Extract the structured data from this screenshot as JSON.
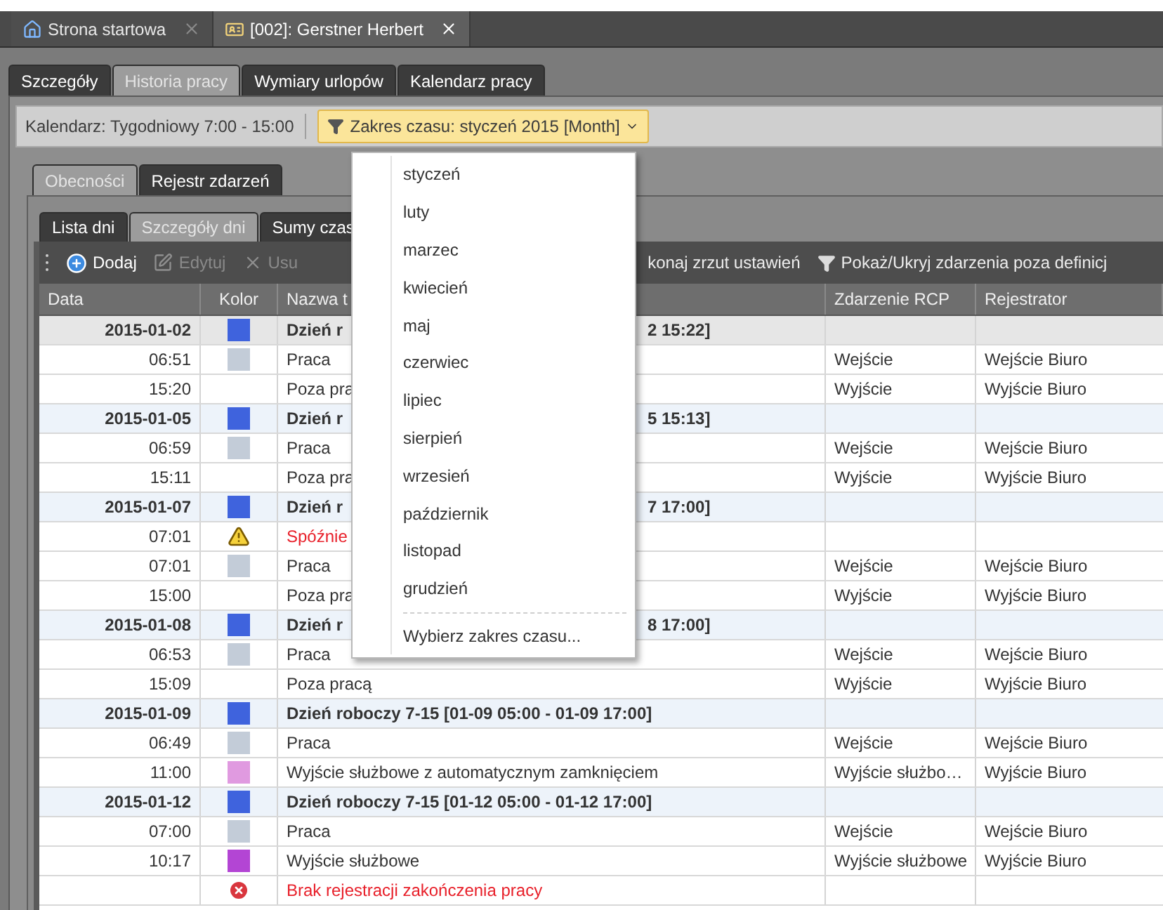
{
  "document_tabs": [
    {
      "label": "Strona startowa",
      "selected": false
    },
    {
      "label": "[002]: Gerstner Herbert",
      "selected": true
    }
  ],
  "section_tabs": [
    {
      "label": "Szczegóły",
      "selected": false
    },
    {
      "label": "Historia pracy",
      "selected": true
    },
    {
      "label": "Wymiary urlopów",
      "selected": false
    },
    {
      "label": "Kalendarz pracy",
      "selected": false
    }
  ],
  "toolbar": {
    "calendar": "Kalendarz: Tygodniowy 7:00 - 15:00",
    "range_button": "Zakres czasu: styczeń 2015 [Month]"
  },
  "view_tabs": [
    {
      "label": "Obecności",
      "selected": true
    },
    {
      "label": "Rejestr zdarzeń",
      "selected": false
    }
  ],
  "sub_tabs": [
    {
      "label": "Lista dni",
      "selected": false
    },
    {
      "label": "Szczegóły dni",
      "selected": true
    },
    {
      "label": "Sumy czas",
      "selected": false
    }
  ],
  "actions": [
    {
      "label": "Dodaj",
      "disabled": false
    },
    {
      "label": "Edytuj",
      "disabled": true
    },
    {
      "label": "Usu",
      "disabled": true
    }
  ],
  "actions_right": [
    "konaj zrzut ustawień",
    "Pokaż/Ukryj zdarzenia poza definicj"
  ],
  "table": {
    "columns": [
      "Data",
      "Kolor",
      "Nazwa t",
      "Zdarzenie RCP",
      "Rejestrator"
    ],
    "rows": [
      {
        "kind": "day",
        "date": "2015-01-02",
        "color": "#3f63dd",
        "name": "Dzień r",
        "name_tail": "2 15:22]",
        "selected": true
      },
      {
        "kind": "event",
        "date": "06:51",
        "color": "#c3ccd8",
        "name": "Praca",
        "event": "Wejście",
        "recorder": "Wejście Biuro"
      },
      {
        "kind": "event",
        "date": "15:20",
        "name": "Poza pra",
        "event": "Wyjście",
        "recorder": "Wyjście Biuro"
      },
      {
        "kind": "day",
        "date": "2015-01-05",
        "color": "#3f63dd",
        "name": "Dzień r",
        "name_tail": "5 15:13]",
        "selected": false
      },
      {
        "kind": "event",
        "date": "06:59",
        "color": "#c3ccd8",
        "name": "Praca",
        "event": "Wejście",
        "recorder": "Wejście Biuro"
      },
      {
        "kind": "event",
        "date": "15:11",
        "name": "Poza pra",
        "event": "Wyjście",
        "recorder": "Wyjście Biuro"
      },
      {
        "kind": "day",
        "date": "2015-01-07",
        "color": "#3f63dd",
        "name": "Dzień r",
        "name_tail": "7 17:00]",
        "selected": false
      },
      {
        "kind": "warning",
        "date": "07:01",
        "name": "Spóźnie"
      },
      {
        "kind": "event",
        "date": "07:01",
        "color": "#c3ccd8",
        "name": "Praca",
        "event": "Wejście",
        "recorder": "Wejście Biuro"
      },
      {
        "kind": "event",
        "date": "15:00",
        "name": "Poza pra",
        "event": "Wyjście",
        "recorder": "Wyjście Biuro"
      },
      {
        "kind": "day",
        "date": "2015-01-08",
        "color": "#3f63dd",
        "name": "Dzień r",
        "name_tail": "8 17:00]",
        "selected": false
      },
      {
        "kind": "event",
        "date": "06:53",
        "color": "#c3ccd8",
        "name": "Praca",
        "event": "Wejście",
        "recorder": "Wejście Biuro"
      },
      {
        "kind": "event",
        "date": "15:09",
        "name": "Poza pracą",
        "event": "Wyjście",
        "recorder": "Wyjście Biuro"
      },
      {
        "kind": "day",
        "date": "2015-01-09",
        "color": "#3f63dd",
        "name": "Dzień roboczy 7-15 [01-09 05:00 - 01-09 17:00]",
        "selected": false
      },
      {
        "kind": "event",
        "date": "06:49",
        "color": "#c3ccd8",
        "name": "Praca",
        "event": "Wejście",
        "recorder": "Wejście Biuro"
      },
      {
        "kind": "event",
        "date": "11:00",
        "color": "#e09ae0",
        "name": "Wyjście służbowe z automatycznym zamknięciem",
        "event": "Wyjście służbo…",
        "recorder": "Wyjście Biuro"
      },
      {
        "kind": "day",
        "date": "2015-01-12",
        "color": "#3f63dd",
        "name": "Dzień roboczy 7-15 [01-12 05:00 - 01-12 17:00]",
        "selected": false
      },
      {
        "kind": "event",
        "date": "07:00",
        "color": "#c3ccd8",
        "name": "Praca",
        "event": "Wejście",
        "recorder": "Wejście Biuro"
      },
      {
        "kind": "event",
        "date": "10:17",
        "color": "#b345d4",
        "name": "Wyjście służbowe",
        "event": "Wyjście służbowe",
        "recorder": "Wyjście Biuro"
      },
      {
        "kind": "error",
        "name": "Brak rejestracji zakończenia pracy"
      }
    ]
  },
  "range_menu": {
    "items": [
      "styczeń",
      "luty",
      "marzec",
      "kwiecień",
      "maj",
      "czerwiec",
      "lipiec",
      "sierpień",
      "wrzesień",
      "październik",
      "listopad",
      "grudzień"
    ],
    "footer": "Wybierz zakres czasu..."
  }
}
